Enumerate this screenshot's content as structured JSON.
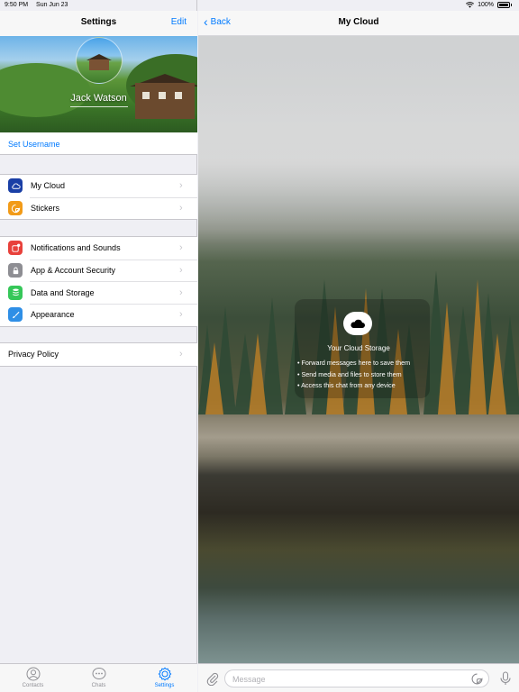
{
  "status_bar": {
    "time": "9:50 PM",
    "date": "Sun Jun 23",
    "battery": "100%"
  },
  "settings": {
    "title": "Settings",
    "edit_label": "Edit",
    "profile_name": "Jack Watson",
    "set_username": "Set Username",
    "group1": [
      {
        "label": "My Cloud",
        "icon": "cloud-icon",
        "color": "#1a3fa6"
      },
      {
        "label": "Stickers",
        "icon": "sticker-icon",
        "color": "#f29b18"
      }
    ],
    "group2": [
      {
        "label": "Notifications and Sounds",
        "icon": "notifications-icon",
        "color": "#e8413b"
      },
      {
        "label": "App & Account Security",
        "icon": "lock-icon",
        "color": "#8e8e93"
      },
      {
        "label": "Data and Storage",
        "icon": "database-icon",
        "color": "#36c759"
      },
      {
        "label": "Appearance",
        "icon": "brush-icon",
        "color": "#2f8fe6"
      }
    ],
    "group3": [
      {
        "label": "Privacy Policy"
      }
    ]
  },
  "tabbar": {
    "tabs": [
      {
        "label": "Contacts",
        "icon": "contacts-icon",
        "active": false
      },
      {
        "label": "Chats",
        "icon": "chats-icon",
        "active": false
      },
      {
        "label": "Settings",
        "icon": "settings-icon",
        "active": true
      }
    ]
  },
  "chat": {
    "back_label": "Back",
    "title": "My Cloud",
    "cloud_title": "Your Cloud Storage",
    "bullets": [
      "• Forward messages here to save them",
      "• Send media and files to store them",
      "• Access this chat from any device"
    ],
    "input_placeholder": "Message"
  },
  "colors": {
    "accent": "#007aff"
  }
}
